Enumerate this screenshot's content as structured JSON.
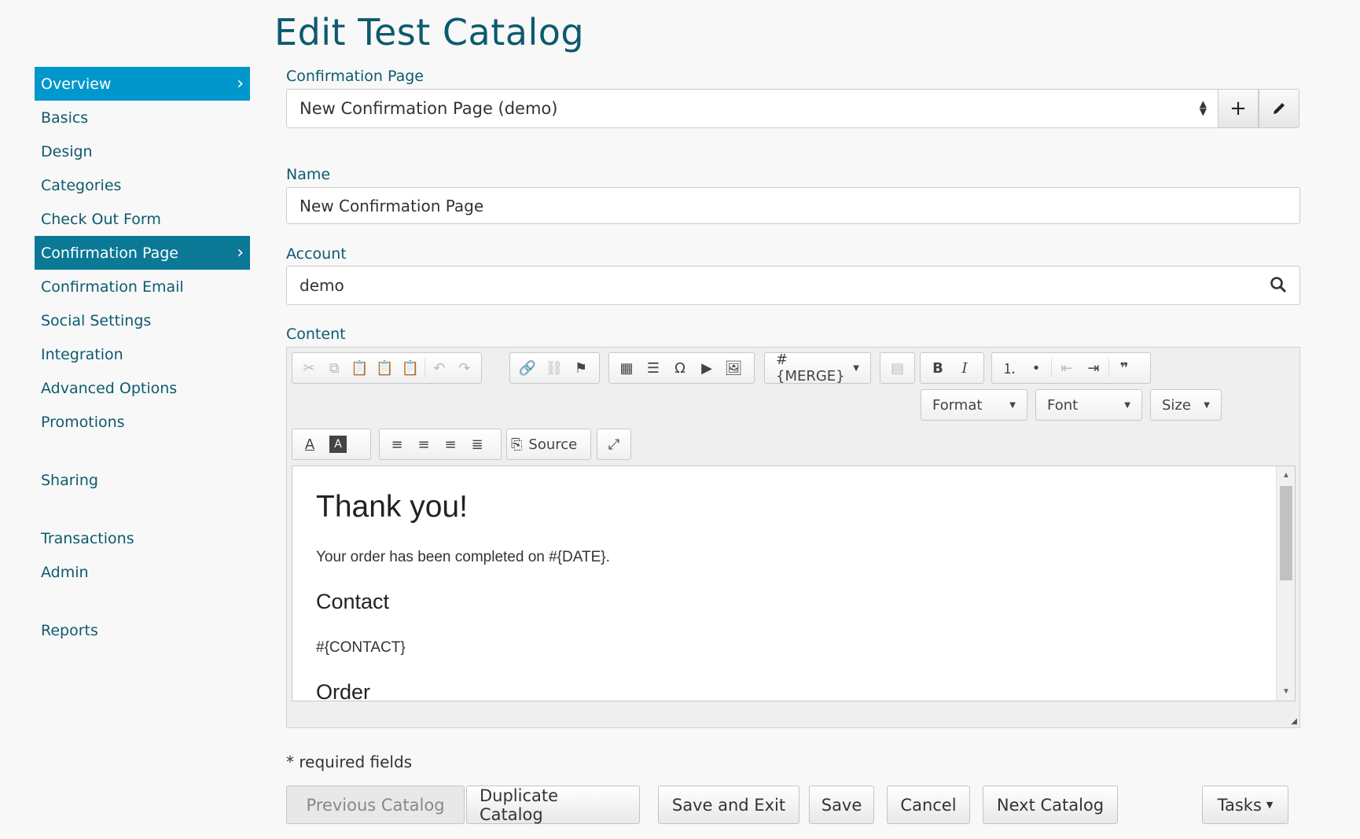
{
  "page": {
    "title": "Edit Test Catalog"
  },
  "sidebar": {
    "items": [
      {
        "label": "Overview",
        "chevron": "›"
      },
      {
        "label": "Basics"
      },
      {
        "label": "Design"
      },
      {
        "label": "Categories"
      },
      {
        "label": "Check Out Form"
      },
      {
        "label": "Confirmation Page",
        "chevron": "›"
      },
      {
        "label": "Confirmation Email"
      },
      {
        "label": "Social Settings"
      },
      {
        "label": "Integration"
      },
      {
        "label": "Advanced Options"
      },
      {
        "label": "Promotions"
      },
      {
        "label": "Sharing"
      },
      {
        "label": "Transactions"
      },
      {
        "label": "Admin"
      },
      {
        "label": "Reports"
      }
    ]
  },
  "form": {
    "confirmation_page": {
      "label": "Confirmation Page",
      "value": "New Confirmation Page (demo)"
    },
    "name": {
      "label": "Name",
      "value": "New Confirmation Page"
    },
    "account": {
      "label": "Account",
      "value": "demo"
    },
    "content": {
      "label": "Content"
    }
  },
  "editor": {
    "merge_label": "#{MERGE}",
    "format_label": "Format",
    "font_label": "Font",
    "size_label": "Size",
    "source_label": "Source",
    "body": {
      "heading": "Thank you!",
      "paragraph": "Your order has been completed on #{DATE}.",
      "contact_heading": "Contact",
      "contact_merge": "#{CONTACT}",
      "order_heading": "Order"
    }
  },
  "footer": {
    "required_note": "* required fields",
    "buttons": {
      "previous": "Previous Catalog",
      "duplicate": "Duplicate Catalog",
      "save_exit": "Save and Exit",
      "save": "Save",
      "cancel": "Cancel",
      "next": "Next Catalog",
      "tasks": "Tasks"
    }
  },
  "colors": {
    "accent": "#0098cc",
    "active_dark": "#0b7895",
    "heading": "#0d5a6e"
  }
}
